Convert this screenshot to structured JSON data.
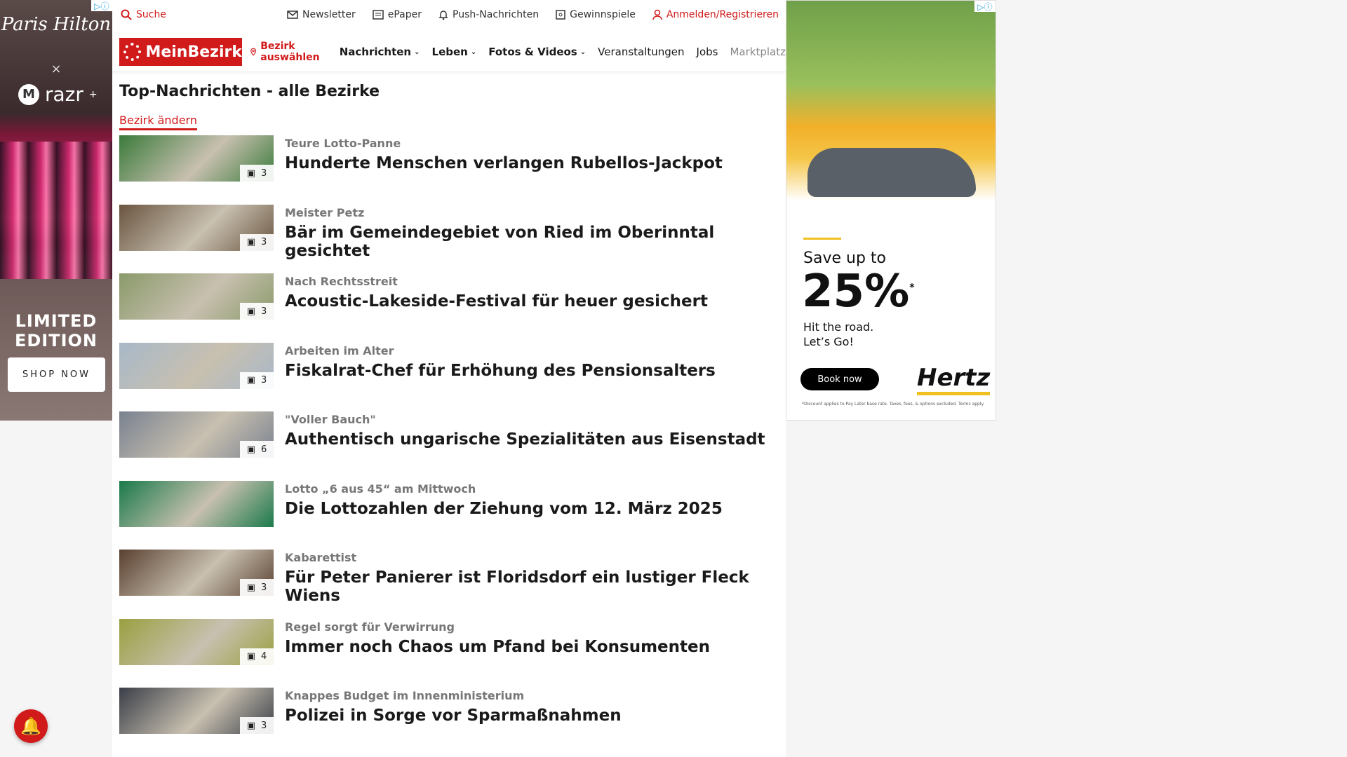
{
  "left_ad": {
    "brand": "Paris Hilton",
    "x": "×",
    "product": "razr",
    "product_sup": "+",
    "limited": "LIMITED EDITION",
    "cta": "SHOP NOW"
  },
  "topbar": {
    "search": "Suche",
    "links": [
      {
        "label": "Newsletter",
        "icon": "mail-icon"
      },
      {
        "label": "ePaper",
        "icon": "newspaper-icon"
      },
      {
        "label": "Push-Nachrichten",
        "icon": "bell-icon"
      },
      {
        "label": "Gewinnspiele",
        "icon": "gift-icon"
      }
    ],
    "login": "Anmelden/Registrieren"
  },
  "nav": {
    "logo": "MeinBezirk",
    "bezirk": "Bezirk auswählen",
    "items": [
      {
        "label": "Nachrichten",
        "dropdown": true
      },
      {
        "label": "Leben",
        "dropdown": true
      },
      {
        "label": "Fotos & Videos",
        "dropdown": true
      },
      {
        "label": "Veranstaltungen",
        "dropdown": false
      },
      {
        "label": "Jobs",
        "dropdown": false
      },
      {
        "label": "Marktplatz",
        "dropdown": false
      }
    ]
  },
  "page": {
    "title": "Top-Nachrichten - alle Bezirke",
    "change_link": "Bezirk ändern"
  },
  "articles": [
    {
      "kicker": "Teure Lotto-Panne",
      "headline": "Hunderte Menschen verlangen Rubellos-Jackpot",
      "count": "3",
      "color": "#3a7a3a"
    },
    {
      "kicker": "Meister Petz",
      "headline": "Bär im Gemeindegebiet von Ried im Oberinntal gesichtet",
      "count": "3",
      "color": "#6a5440"
    },
    {
      "kicker": "Nach Rechtsstreit",
      "headline": "Acoustic-Lakeside-Festival für heuer gesichert",
      "count": "3",
      "color": "#8a9a6a"
    },
    {
      "kicker": "Arbeiten im Alter",
      "headline": "Fiskalrat-Chef für Erhöhung des Pensionsalters",
      "count": "3",
      "color": "#a8b8c8"
    },
    {
      "kicker": "\"Voller Bauch\"",
      "headline": "Authentisch ungarische Spezialitäten aus Eisenstadt",
      "count": "6",
      "color": "#7a8290"
    },
    {
      "kicker": "Lotto „6 aus 45“ am Mittwoch",
      "headline": "Die Lottozahlen der Ziehung vom 12. März 2025",
      "count": "",
      "color": "#1a7a4a"
    },
    {
      "kicker": "Kabarettist",
      "headline": "Für Peter Panierer ist Floridsdorf ein lustiger Fleck Wiens",
      "count": "3",
      "color": "#5a4030"
    },
    {
      "kicker": "Regel sorgt für Verwirrung",
      "headline": "Immer noch Chaos um Pfand bei Konsumenten",
      "count": "4",
      "color": "#9aa040"
    },
    {
      "kicker": "Knappes Budget im Innenministerium",
      "headline": "Polizei in Sorge vor Sparmaßnahmen",
      "count": "3",
      "color": "#3a3e48"
    }
  ],
  "right_ad": {
    "save": "Save up to",
    "pct": "25%",
    "asterisk": "*",
    "tagline1": "Hit the road.",
    "tagline2": "Let’s Go!",
    "cta": "Book now",
    "brand": "Hertz",
    "fine": "*Discount applies to Pay Later base rate. Taxes, fees, & options excluded. Terms apply."
  },
  "colors": {
    "brand_red": "#d11a1a",
    "hertz_yellow": "#f0c020"
  }
}
